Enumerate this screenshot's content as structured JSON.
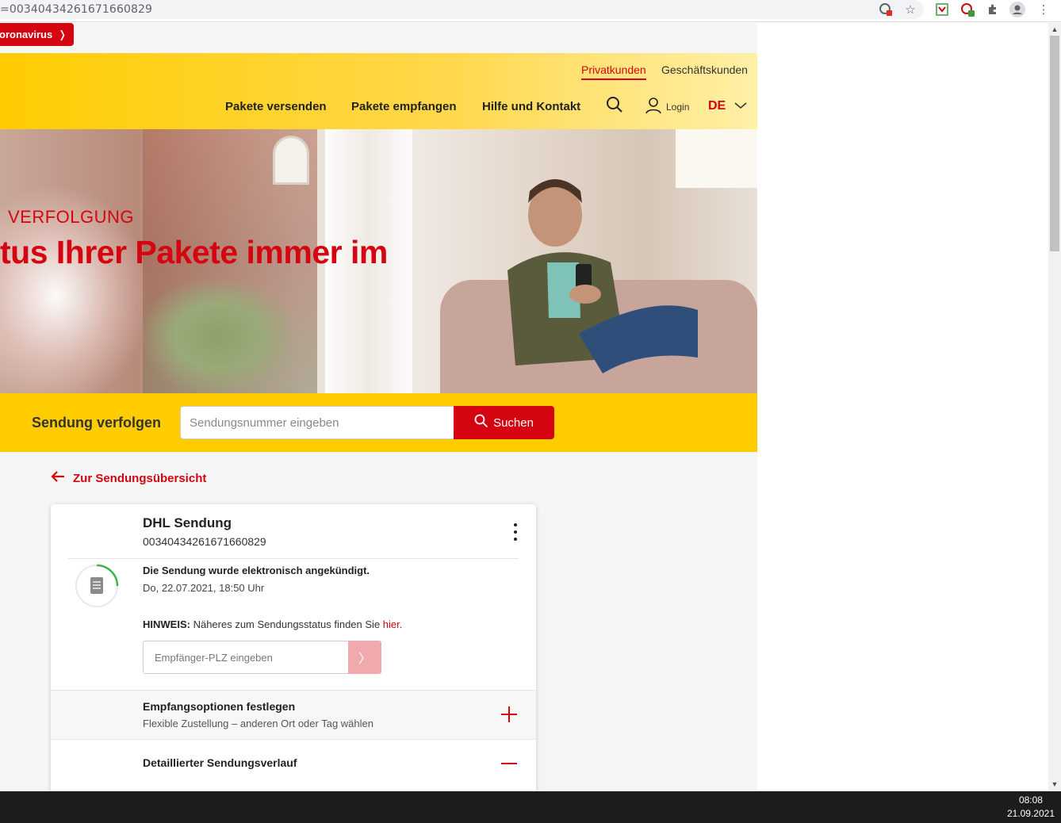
{
  "browser": {
    "url": "=00340434261671660829"
  },
  "banner": {
    "corona_label": "oronavirus"
  },
  "header": {
    "segments": [
      "Privatkunden",
      "Geschäftskunden"
    ],
    "nav": [
      "Pakete versenden",
      "Pakete empfangen",
      "Hilfe und Kontakt"
    ],
    "login_label": "Login",
    "language": "DE"
  },
  "hero": {
    "kicker": "VERFOLGUNG",
    "headline": "tus Ihrer Pakete immer im"
  },
  "tracking": {
    "label": "Sendung verfolgen",
    "placeholder": "Sendungsnummer eingeben",
    "button_label": "Suchen"
  },
  "back_link": "Zur Sendungsübersicht",
  "shipment": {
    "title": "DHL Sendung",
    "number": "00340434261671660829",
    "status_text": "Die Sendung wurde elektronisch angekündigt.",
    "status_date": "Do, 22.07.2021, 18:50 Uhr",
    "hint_label": "HINWEIS:",
    "hint_text": "Näheres zum Sendungsstatus finden Sie",
    "hint_link": "hier",
    "plz_placeholder": "Empfänger-PLZ eingeben",
    "options_title": "Empfangsoptionen festlegen",
    "options_subtitle": "Flexible Zustellung – anderen Ort oder Tag wählen",
    "history_title": "Detaillierter Sendungsverlauf"
  },
  "taskbar": {
    "time": "08:08",
    "date": "21.09.2021"
  },
  "colors": {
    "brand_red": "#d40511",
    "brand_yellow": "#ffcc00"
  }
}
